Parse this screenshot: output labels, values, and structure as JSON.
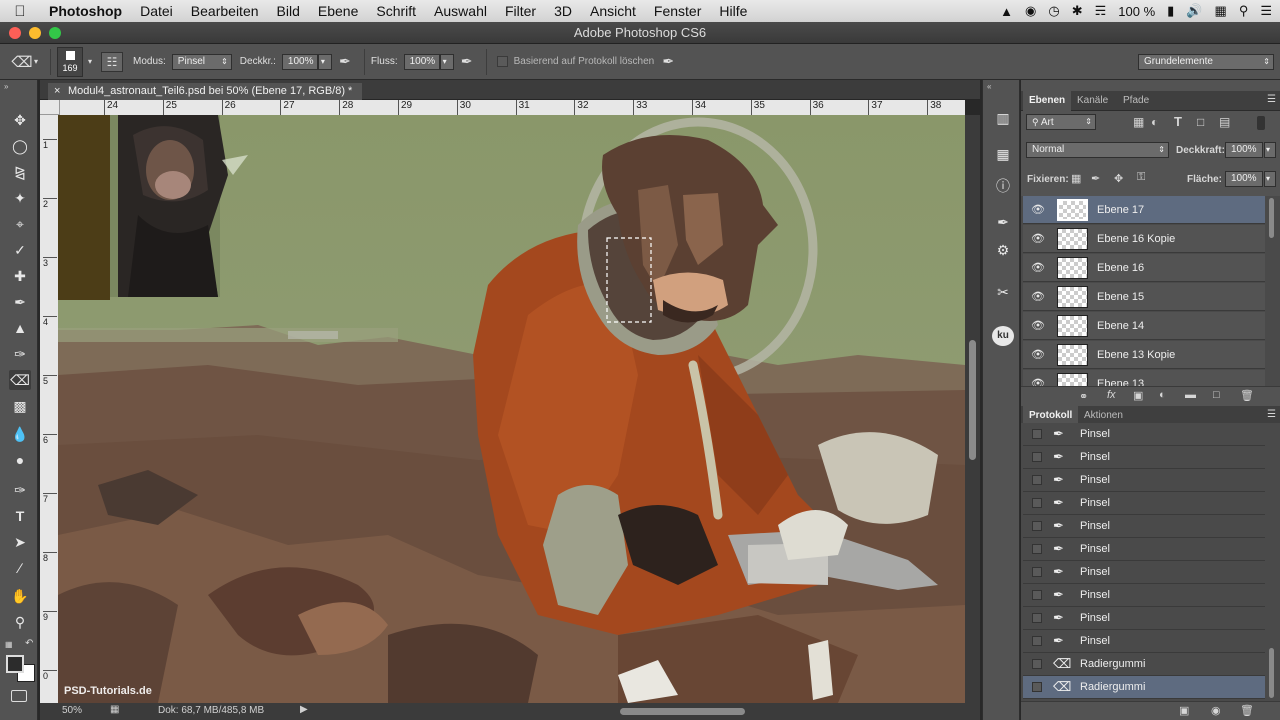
{
  "menubar": {
    "app": "Photoshop",
    "items": [
      "Datei",
      "Bearbeiten",
      "Bild",
      "Ebene",
      "Schrift",
      "Auswahl",
      "Filter",
      "3D",
      "Ansicht",
      "Fenster",
      "Hilfe"
    ],
    "battery": "100 %"
  },
  "window": {
    "title": "Adobe Photoshop CS6"
  },
  "options": {
    "brush_size": "169",
    "mode_label": "Modus:",
    "mode_value": "Pinsel",
    "opacity_label": "Deckkr.:",
    "opacity_value": "100%",
    "flow_label": "Fluss:",
    "flow_value": "100%",
    "history_erase_label": "Basierend auf Protokoll löschen",
    "workspace": "Grundelemente"
  },
  "document": {
    "tab_title": "Modul4_astronaut_Teil6.psd bei 50% (Ebene 17, RGB/8) *",
    "ruler_h": [
      "24",
      "25",
      "26",
      "27",
      "28",
      "29",
      "30",
      "31",
      "32",
      "33",
      "34",
      "35",
      "36",
      "37",
      "38"
    ],
    "ruler_v": [
      "1",
      "2",
      "3",
      "4",
      "5",
      "6",
      "7",
      "8",
      "9",
      "0"
    ],
    "zoom": "50%",
    "doc_info": "Dok: 68,7 MB/485,8 MB",
    "watermark": "PSD-Tutorials.de"
  },
  "layers_panel": {
    "tabs": [
      "Ebenen",
      "Kanäle",
      "Pfade"
    ],
    "filter_kind": "Art",
    "blend_mode": "Normal",
    "opacity_label": "Deckkraft:",
    "opacity_value": "100%",
    "lock_label": "Fixieren:",
    "fill_label": "Fläche:",
    "fill_value": "100%",
    "layers": [
      {
        "name": "Ebene 17",
        "selected": true
      },
      {
        "name": "Ebene 16 Kopie",
        "selected": false
      },
      {
        "name": "Ebene 16",
        "selected": false
      },
      {
        "name": "Ebene 15",
        "selected": false
      },
      {
        "name": "Ebene 14",
        "selected": false
      },
      {
        "name": "Ebene 13 Kopie",
        "selected": false
      },
      {
        "name": "Ebene 13",
        "selected": false
      }
    ]
  },
  "history_panel": {
    "tabs": [
      "Protokoll",
      "Aktionen"
    ],
    "items": [
      "Pinsel",
      "Pinsel",
      "Pinsel",
      "Pinsel",
      "Pinsel",
      "Pinsel",
      "Pinsel",
      "Pinsel",
      "Pinsel",
      "Pinsel",
      "Radiergummi",
      "Radiergummi"
    ]
  },
  "colors": {
    "sky": "#8d9a6e",
    "suit": "#a4481e",
    "ground": "#6f5242",
    "selection_blue": "#5e6b80"
  }
}
